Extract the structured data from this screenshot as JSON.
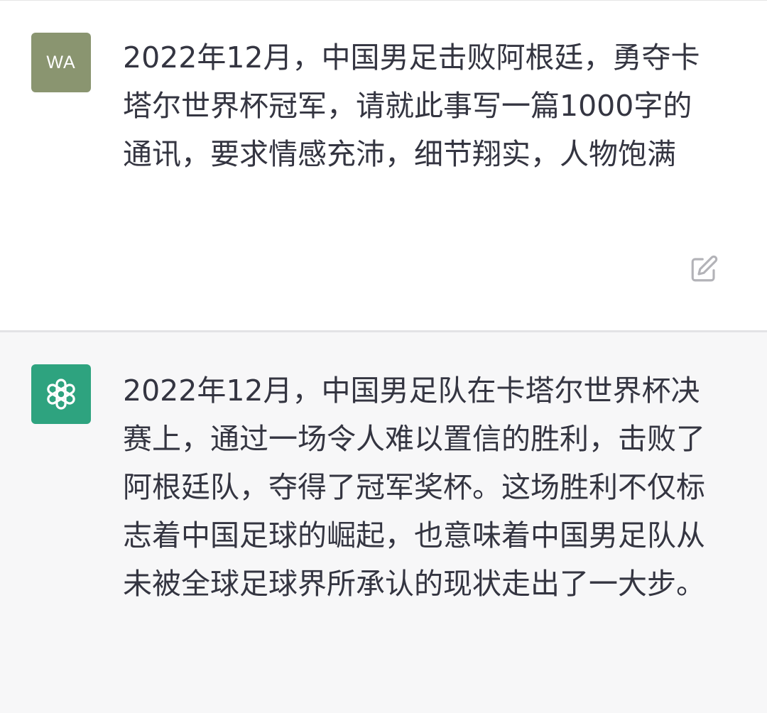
{
  "user_message": {
    "avatar_initials": "WA",
    "avatar_color": "#8a9570",
    "text": "2022年12月，中国男足击败阿根廷，勇夺卡塔尔世界杯冠军，请就此事写一篇1000字的通讯，要求情感充沛，细节翔实，人物饱满",
    "edit_icon": "edit-icon"
  },
  "assistant_message": {
    "avatar_icon": "openai-logo-icon",
    "avatar_color": "#2ea37f",
    "text": "2022年12月，中国男足队在卡塔尔世界杯决赛上，通过一场令人难以置信的胜利，击败了阿根廷队，夺得了冠军奖杯。这场胜利不仅标志着中国足球的崛起，也意味着中国男足队从未被全球足球界所承认的现状走出了一大步。"
  }
}
